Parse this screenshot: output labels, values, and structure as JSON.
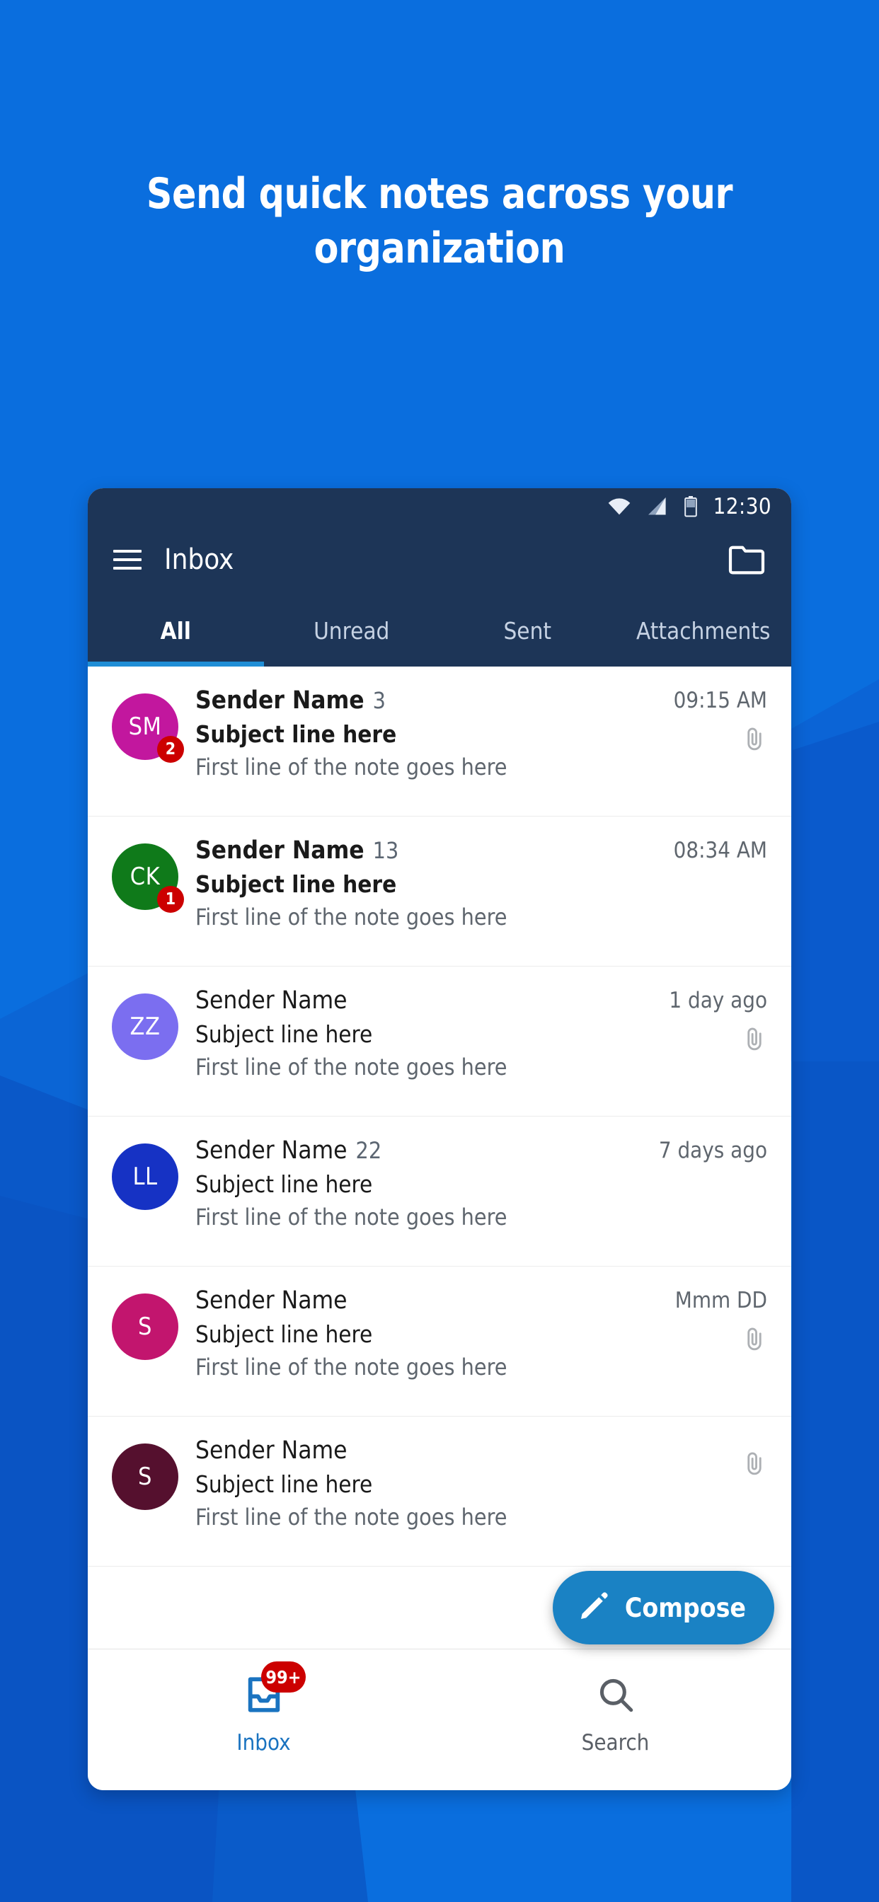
{
  "headline": "Send quick notes across your organization",
  "colors": {
    "bg_blue": "#0a6ede",
    "bg_blue_dark": "#0b4fc1",
    "bg_blue_mid": "#0b57cc",
    "bg_blue_light": "#1277e6",
    "appbar_navy": "#1d3557",
    "accent_tab": "#1f8ed6",
    "fab_blue": "#1a82c4",
    "badge_red": "#cc0000",
    "nav_active": "#1a73c0"
  },
  "status_bar": {
    "time": "12:30",
    "icons": [
      "wifi-icon",
      "cellular-signal-icon",
      "battery-icon"
    ]
  },
  "app_bar": {
    "menu_icon": "hamburger-menu-icon",
    "title": "Inbox",
    "action_icon": "folder-icon"
  },
  "tabs": [
    {
      "label": "All",
      "active": true
    },
    {
      "label": "Unread",
      "active": false
    },
    {
      "label": "Sent",
      "active": false
    },
    {
      "label": "Attachments",
      "active": false
    }
  ],
  "messages": [
    {
      "initials": "SM",
      "avatar_color": "#c2179e",
      "badge": "2",
      "sender": "Sender Name",
      "count": "3",
      "subject": "Subject line here",
      "preview": "First line of the note goes here",
      "time": "09:15 AM",
      "attachment": true,
      "unread": true
    },
    {
      "initials": "CK",
      "avatar_color": "#0f7a1a",
      "badge": "1",
      "sender": "Sender Name",
      "count": "13",
      "subject": "Subject line here",
      "preview": "First line of the note goes here",
      "time": "08:34 AM",
      "attachment": false,
      "unread": true
    },
    {
      "initials": "ZZ",
      "avatar_color": "#7b6ef0",
      "badge": "",
      "sender": "Sender Name",
      "count": "",
      "subject": "Subject line here",
      "preview": "First line of the note goes here",
      "time": "1 day ago",
      "attachment": true,
      "unread": false
    },
    {
      "initials": "LL",
      "avatar_color": "#1632c4",
      "badge": "",
      "sender": "Sender Name",
      "count": "22",
      "subject": "Subject line here",
      "preview": "First line of the note goes here",
      "time": "7 days ago",
      "attachment": false,
      "unread": false
    },
    {
      "initials": "S",
      "avatar_color": "#c2156e",
      "badge": "",
      "sender": "Sender Name",
      "count": "",
      "subject": "Subject line here",
      "preview": "First line of the note goes here",
      "time": "Mmm DD",
      "attachment": true,
      "unread": false
    },
    {
      "initials": "S",
      "avatar_color": "#55102e",
      "badge": "",
      "sender": "Sender Name",
      "count": "",
      "subject": "Subject line here",
      "preview": "First line of the note goes here",
      "time": "",
      "attachment": true,
      "unread": false
    }
  ],
  "fab": {
    "label": "Compose",
    "icon": "pencil-icon"
  },
  "bottom_nav": [
    {
      "label": "Inbox",
      "icon": "inbox-icon",
      "badge": "99+",
      "active": true
    },
    {
      "label": "Search",
      "icon": "search-icon",
      "badge": "",
      "active": false
    }
  ]
}
